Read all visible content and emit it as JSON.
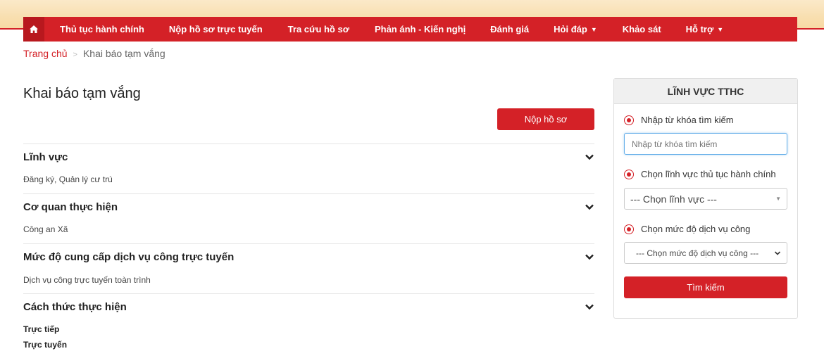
{
  "nav": {
    "home_icon": "home-icon",
    "items": [
      {
        "label": "Thủ tục hành chính",
        "dropdown": false
      },
      {
        "label": "Nộp hồ sơ trực tuyến",
        "dropdown": false
      },
      {
        "label": "Tra cứu hồ sơ",
        "dropdown": false
      },
      {
        "label": "Phản ánh - Kiến nghị",
        "dropdown": false
      },
      {
        "label": "Đánh giá",
        "dropdown": false
      },
      {
        "label": "Hỏi đáp",
        "dropdown": true
      },
      {
        "label": "Khảo sát",
        "dropdown": false
      },
      {
        "label": "Hỗ trợ",
        "dropdown": true
      }
    ]
  },
  "breadcrumb": {
    "home": "Trang chủ",
    "separator": ">",
    "current": "Khai báo tạm vắng"
  },
  "page": {
    "title": "Khai báo tạm vắng",
    "submit_label": "Nộp hồ sơ"
  },
  "sections": [
    {
      "title": "Lĩnh vực",
      "values": [
        "Đăng ký, Quản lý cư trú"
      ]
    },
    {
      "title": "Cơ quan thực hiện",
      "values": [
        "Công an Xã"
      ]
    },
    {
      "title": "Mức độ cung cấp dịch vụ công trực tuyến",
      "values": [
        "Dịch vụ công trực tuyến toàn trình"
      ]
    },
    {
      "title": "Cách thức thực hiện",
      "values": [
        "Trực tiếp",
        "Trực tuyến"
      ]
    }
  ],
  "panel": {
    "title": "LĨNH VỰC TTHC",
    "keyword_label": "Nhập từ khóa tìm kiếm",
    "keyword_placeholder": "Nhập từ khóa tìm kiếm",
    "field_label": "Chọn lĩnh vực thủ tục hành chính",
    "field_select": "--- Chọn lĩnh vực ---",
    "level_label": "Chọn mức độ dịch vụ công",
    "level_select": "--- Chọn mức độ dịch vụ công ---",
    "search_label": "Tìm kiếm"
  },
  "colors": {
    "brand": "#d42127",
    "banner": "#f8dfb0"
  }
}
